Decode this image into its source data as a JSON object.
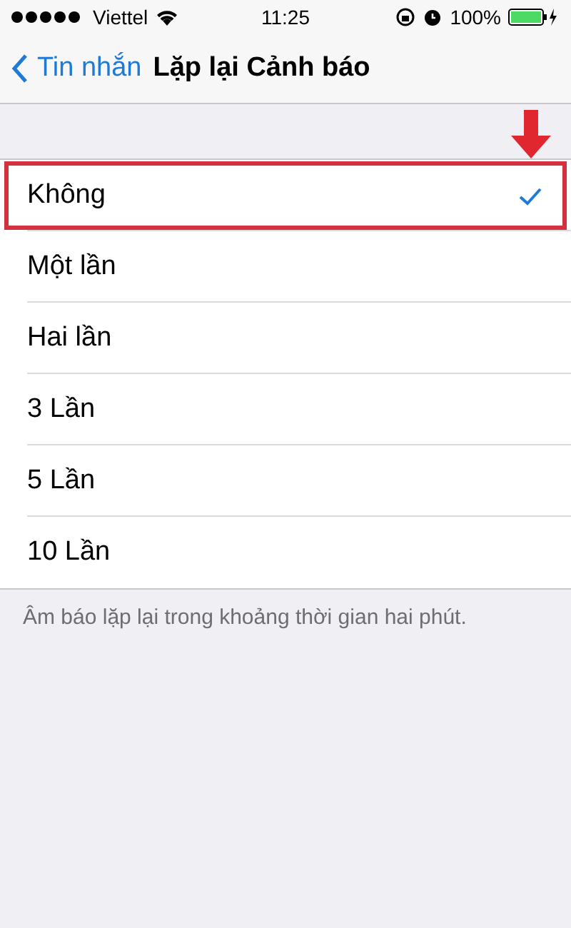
{
  "status_bar": {
    "carrier": "Viettel",
    "time": "11:25",
    "battery": "100%"
  },
  "nav": {
    "back": "Tin nhắn",
    "title": "Lặp lại Cảnh báo"
  },
  "options": [
    {
      "label": "Không",
      "selected": true,
      "highlighted": true
    },
    {
      "label": "Một lần",
      "selected": false,
      "highlighted": false
    },
    {
      "label": "Hai lần",
      "selected": false,
      "highlighted": false
    },
    {
      "label": "3 Lần",
      "selected": false,
      "highlighted": false
    },
    {
      "label": "5 Lần",
      "selected": false,
      "highlighted": false
    },
    {
      "label": "10 Lần",
      "selected": false,
      "highlighted": false
    }
  ],
  "footer": "Âm báo lặp lại trong khoảng thời gian hai phút."
}
